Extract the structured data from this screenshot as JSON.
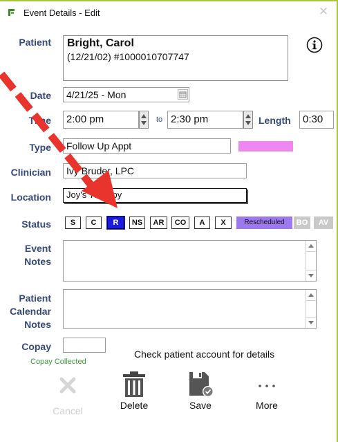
{
  "window": {
    "title": "Event Details - Edit",
    "close_glyph": "✕",
    "app_icon": "app-logo-icon"
  },
  "patient": {
    "label": "Patient",
    "name": "Bright, Carol",
    "details": "(12/21/02) #1000010707747",
    "info_icon": "info-icon"
  },
  "date": {
    "label": "Date",
    "value": "4/21/25 - Mon"
  },
  "time": {
    "label": "Time",
    "start": "2:00 pm",
    "to_label": "to",
    "end": "2:30 pm",
    "length_label": "Length",
    "length_value": "0:30"
  },
  "type": {
    "label": "Type",
    "value": "Follow Up Appt",
    "color": "#ee88ee"
  },
  "clinician": {
    "label": "Clinician",
    "value": "Ivy Bruder, LPC"
  },
  "location": {
    "label": "Location",
    "value": "Joy's Therapy"
  },
  "status": {
    "label": "Status",
    "buttons": [
      "S",
      "C",
      "R",
      "NS",
      "AR",
      "CO",
      "A",
      "X"
    ],
    "selected": "R",
    "rescheduled_label": "Rescheduled",
    "disabled_buttons": [
      "BO",
      "AV"
    ]
  },
  "event_notes": {
    "label_line1": "Event",
    "label_line2": "Notes",
    "value": ""
  },
  "calendar_notes": {
    "label_line1": "Patient",
    "label_line2": "Calendar",
    "label_line3": "Notes",
    "value": ""
  },
  "copay": {
    "label": "Copay",
    "value": "",
    "collected_label": "Copay Collected",
    "account_note": "Check patient account for details"
  },
  "toolbar": {
    "cancel_label": "Cancel",
    "delete_label": "Delete",
    "save_label": "Save",
    "more_label": "More"
  },
  "colors": {
    "label_text": "#354a7a",
    "selected_status": "#1a1ae0",
    "rescheduled": "#9c79ef",
    "annotation_arrow": "#e8342c",
    "copay_collected": "#3a9a3a"
  }
}
